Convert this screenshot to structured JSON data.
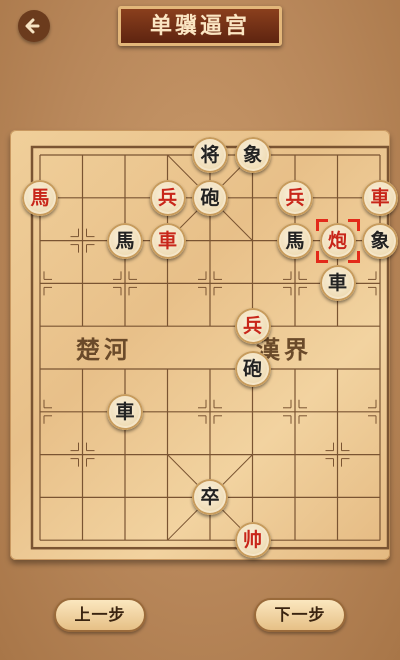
{
  "header": {
    "title": "单骥逼宫",
    "back_icon": "arrow-left-icon"
  },
  "board": {
    "river_left": "楚河",
    "river_right": "漢界",
    "pieces": [
      {
        "side": "black",
        "char": "将",
        "col": 4,
        "row": 0
      },
      {
        "side": "black",
        "char": "象",
        "col": 5,
        "row": 0
      },
      {
        "side": "red",
        "char": "馬",
        "col": 0,
        "row": 1
      },
      {
        "side": "red",
        "char": "兵",
        "col": 3,
        "row": 1
      },
      {
        "side": "black",
        "char": "砲",
        "col": 4,
        "row": 1
      },
      {
        "side": "red",
        "char": "兵",
        "col": 6,
        "row": 1
      },
      {
        "side": "red",
        "char": "車",
        "col": 8,
        "row": 1
      },
      {
        "side": "black",
        "char": "馬",
        "col": 2,
        "row": 2
      },
      {
        "side": "red",
        "char": "車",
        "col": 3,
        "row": 2
      },
      {
        "side": "black",
        "char": "馬",
        "col": 6,
        "row": 2
      },
      {
        "side": "red",
        "char": "炮",
        "col": 7,
        "row": 2,
        "selected": true
      },
      {
        "side": "black",
        "char": "象",
        "col": 8,
        "row": 2
      },
      {
        "side": "black",
        "char": "車",
        "col": 7,
        "row": 3
      },
      {
        "side": "red",
        "char": "兵",
        "col": 5,
        "row": 4
      },
      {
        "side": "black",
        "char": "砲",
        "col": 5,
        "row": 5
      },
      {
        "side": "black",
        "char": "車",
        "col": 2,
        "row": 6
      },
      {
        "side": "black",
        "char": "卒",
        "col": 4,
        "row": 8
      },
      {
        "side": "red",
        "char": "帅",
        "col": 5,
        "row": 9
      }
    ]
  },
  "controls": {
    "prev_label": "上一步",
    "next_label": "下一步"
  },
  "colors": {
    "red_piece": "#c8261a",
    "black_piece": "#222222",
    "selection": "#e32a1a"
  }
}
